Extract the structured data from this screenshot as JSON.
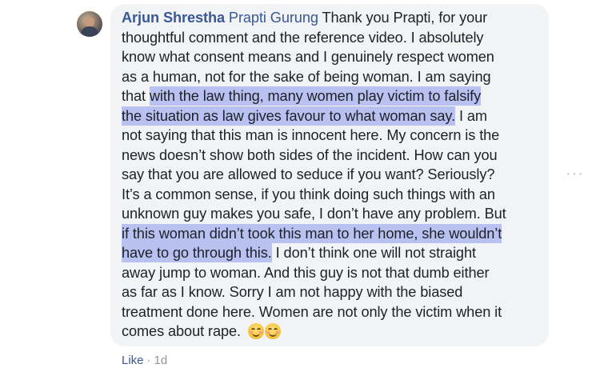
{
  "comment": {
    "author": "Arjun Shrestha",
    "mention": "Prapti Gurung",
    "lines": {
      "l1": " Thank you Prapti, for your",
      "l2": "thoughtful comment and the reference video. I absolutely",
      "l3": "know what consent means and I genuinely respect women",
      "l4": "as a human, not for the sake of being woman. I am saying",
      "l5_pre": "that ",
      "l5_hl": "with the law thing, many women play victim to falsify",
      "l6_hl": "the situation as law gives favour to what woman say.",
      "l6_post": " I am",
      "l7": "not saying that this man is innocent here. My concern is the",
      "l8": "news doesn’t show both sides of the incident. How can you",
      "l9": "say that you are allowed to seduce if you want? Seriously?",
      "l10": "It’s a common sense, if you think doing such things with an",
      "l11": "unknown guy makes you safe, I don’t have any problem. But",
      "l12_hl": "if this woman didn’t took this man to her home, she wouldn’t",
      "l13_hl": "have to go through this.",
      "l13_post": " I don’t think one will not straight",
      "l14": "away jump to woman. And this guy is not that dumb either",
      "l15": "as far as I know. Sorry I am not happy with the biased",
      "l16": "treatment done here. Women are not only the victim when it",
      "l17": "comes about rape. "
    },
    "emojis": [
      "smiling-face-icon",
      "smiling-face-icon"
    ]
  },
  "footer": {
    "like_label": "Like",
    "separator": "·",
    "time": "1d"
  },
  "more_options": "···",
  "colors": {
    "link": "#385898",
    "highlight": "#b9c1f0",
    "bubble": "#f2f3f5",
    "text": "#1d2129",
    "meta": "#90949c"
  }
}
